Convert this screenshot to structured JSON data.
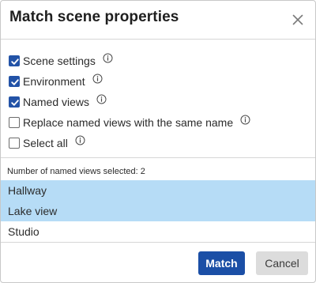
{
  "dialog": {
    "title": "Match scene properties",
    "close_icon": "close-icon"
  },
  "options": [
    {
      "label": "Scene settings",
      "checked": true,
      "info_icon": "info-icon"
    },
    {
      "label": "Environment",
      "checked": true,
      "info_icon": "info-icon"
    },
    {
      "label": "Named views",
      "checked": true,
      "info_icon": "info-icon"
    },
    {
      "label": "Replace named views with the same name",
      "checked": false,
      "info_icon": "info-icon"
    },
    {
      "label": "Select all",
      "checked": false,
      "info_icon": "info-icon"
    }
  ],
  "named_views": {
    "count_text": "Number of named views selected: 2",
    "items": [
      {
        "label": "Hallway",
        "selected": true
      },
      {
        "label": "Lake view",
        "selected": true
      },
      {
        "label": "Studio",
        "selected": false
      }
    ]
  },
  "buttons": {
    "match_label": "Match",
    "cancel_label": "Cancel"
  },
  "colors": {
    "primary": "#1b4fa6",
    "checkbox_checked": "#2353a7",
    "selection": "#b6dcf6"
  }
}
